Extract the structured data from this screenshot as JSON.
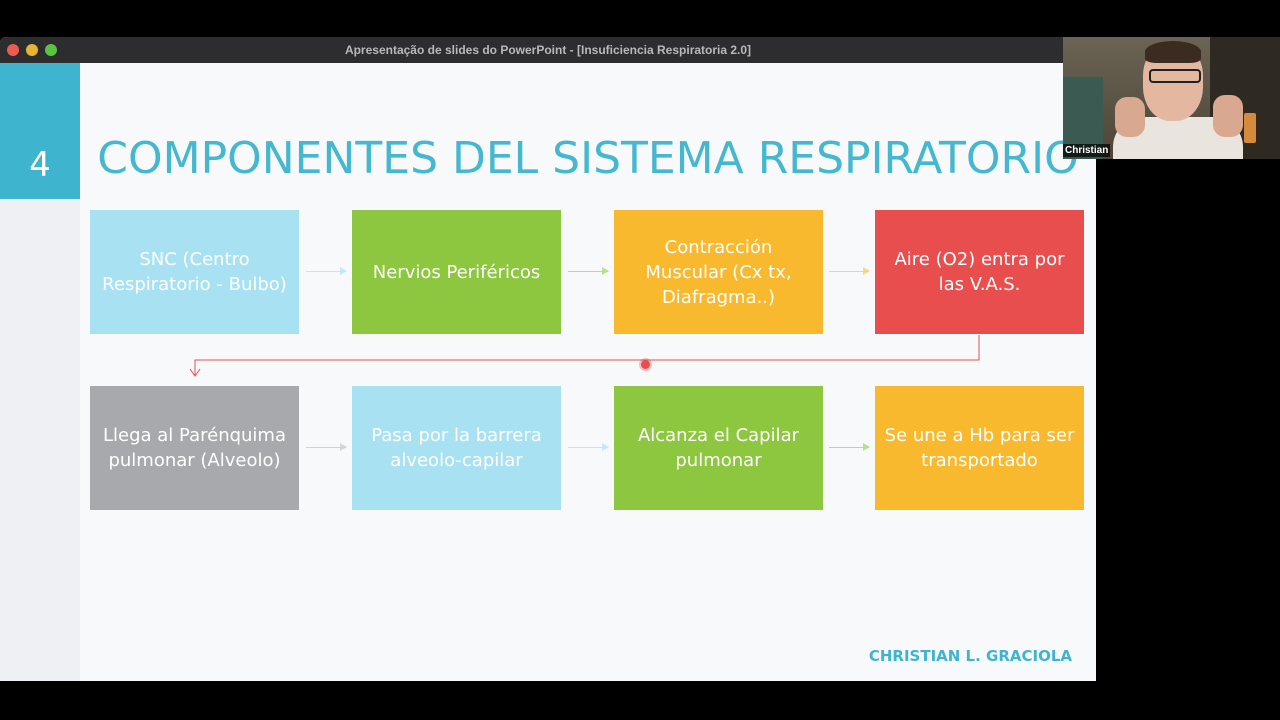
{
  "window": {
    "title": "Apresentação de slides do PowerPoint - [Insuficiencia Respiratoria 2.0]"
  },
  "slide": {
    "number": "4",
    "title": "COMPONENTES DEL SISTEMA RESPIRATORIO",
    "row1": [
      {
        "label": "SNC (Centro Respiratorio - Bulbo)",
        "color": "#a8e2f2"
      },
      {
        "label": "Nervios Periféricos",
        "color": "#8dc63f"
      },
      {
        "label": "Contracción Muscular (Cx tx, Diafragma..)",
        "color": "#f9b92f"
      },
      {
        "label": "Aire (O2) entra por las V.A.S.",
        "color": "#e94e4f"
      }
    ],
    "row2": [
      {
        "label": "Llega al Parénquima pulmonar (Alveolo)",
        "color": "#a7a9ac"
      },
      {
        "label": "Pasa por la barrera alveolo-capilar",
        "color": "#a8e2f2"
      },
      {
        "label": "Alcanza el Capilar pulmonar",
        "color": "#8dc63f"
      },
      {
        "label": "Se une a Hb para ser transportado",
        "color": "#f9b92f"
      }
    ],
    "author": "CHRISTIAN L. GRACIOLA"
  },
  "webcam": {
    "participant_name": "Christian"
  },
  "colors": {
    "accent": "#3eb4cf",
    "connector": "#e94e4f"
  }
}
